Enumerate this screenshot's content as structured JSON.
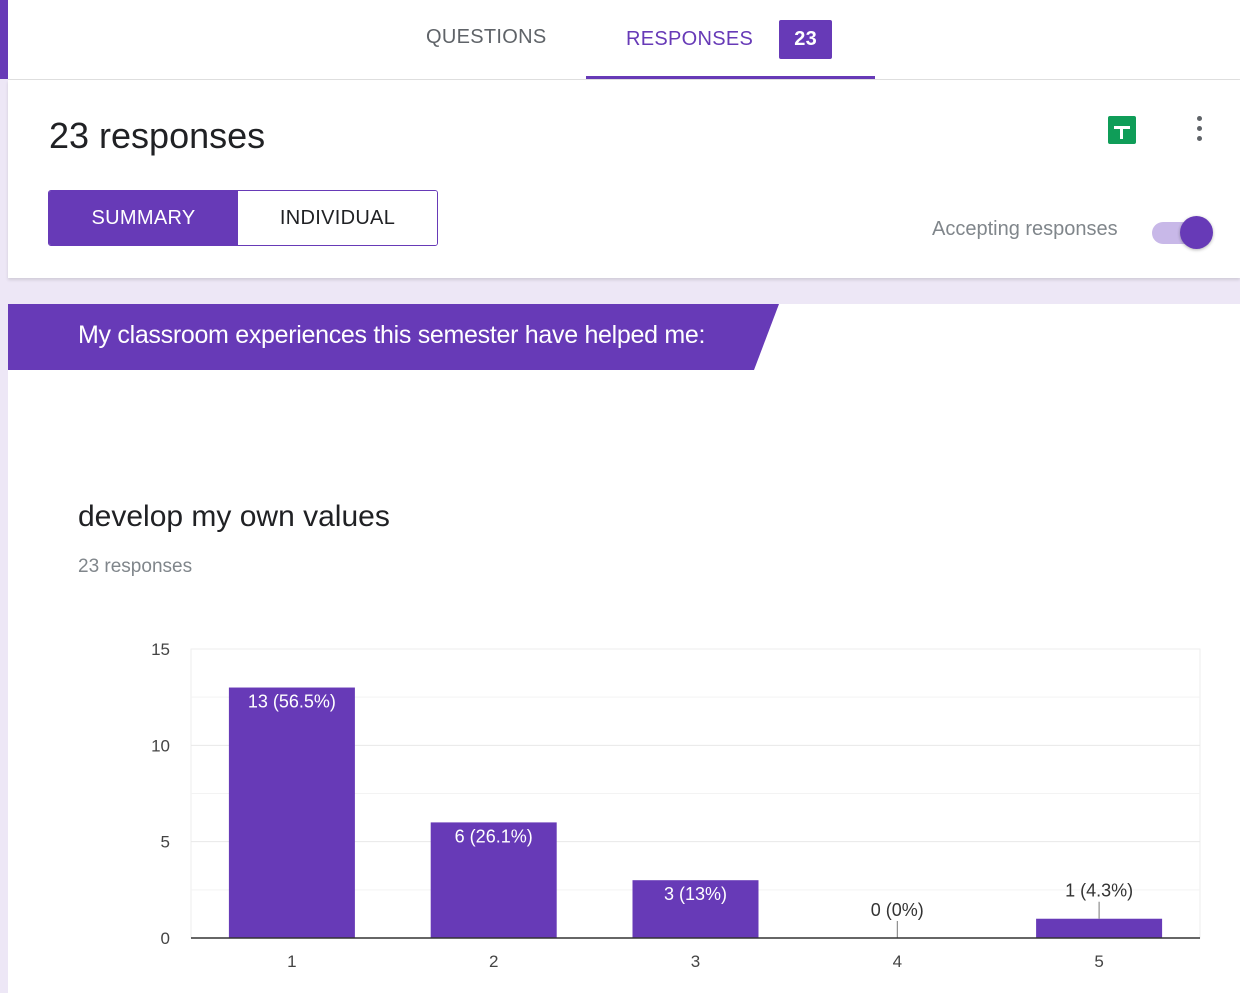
{
  "tabs": {
    "questions_label": "QUESTIONS",
    "responses_label": "RESPONSES",
    "responses_badge": "23"
  },
  "header": {
    "title": "23 responses",
    "summary_label": "SUMMARY",
    "individual_label": "INDIVIDUAL",
    "accepting_label": "Accepting responses",
    "accepting_on": true,
    "sheets_icon": "google-sheets-icon",
    "more_icon": "more-vert-icon"
  },
  "question": {
    "banner_text": "My classroom experiences this semester have helped me:",
    "subquestion": "develop my own values",
    "response_count": "23 responses"
  },
  "colors": {
    "accent": "#673ab7",
    "accent_light": "#c8b8e8",
    "sheets_green": "#0f9d58",
    "page_bg": "#ede7f6"
  },
  "chart_data": {
    "type": "bar",
    "categories": [
      "1",
      "2",
      "3",
      "4",
      "5"
    ],
    "values": [
      13,
      6,
      3,
      0,
      1
    ],
    "data_labels": [
      "13 (56.5%)",
      "6 (26.1%)",
      "3 (13%)",
      "0 (0%)",
      "1 (4.3%)"
    ],
    "y_ticks": [
      "0",
      "5",
      "10",
      "15"
    ],
    "ylim": [
      0,
      15
    ],
    "grid": true,
    "color": "#673ab7"
  }
}
